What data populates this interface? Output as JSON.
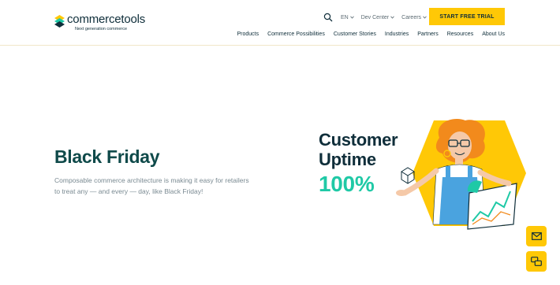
{
  "brand": {
    "name": "commercetools",
    "tagline": "Next generation commerce"
  },
  "utility": {
    "language": "EN",
    "dev_center": "Dev Center",
    "careers": "Careers",
    "cta": "START FREE TRIAL"
  },
  "nav": {
    "items": [
      {
        "label": "Products"
      },
      {
        "label": "Commerce Possibilities"
      },
      {
        "label": "Customer Stories"
      },
      {
        "label": "Industries"
      },
      {
        "label": "Partners"
      },
      {
        "label": "Resources"
      },
      {
        "label": "About Us"
      }
    ]
  },
  "hero": {
    "title": "Black Friday",
    "description": "Composable commerce architecture is making it easy for retailers to treat any — and every — day, like Black Friday!",
    "uptime_line1": "Customer",
    "uptime_line2": "Uptime",
    "uptime_value": "100%"
  },
  "icons": {
    "search": "search-icon",
    "mail": "mail-icon",
    "chat": "chat-icon"
  },
  "colors": {
    "accent": "#ffc806",
    "dark": "#0f2e3a",
    "teal": "#1fc9a6",
    "title": "#0f4a4a"
  }
}
